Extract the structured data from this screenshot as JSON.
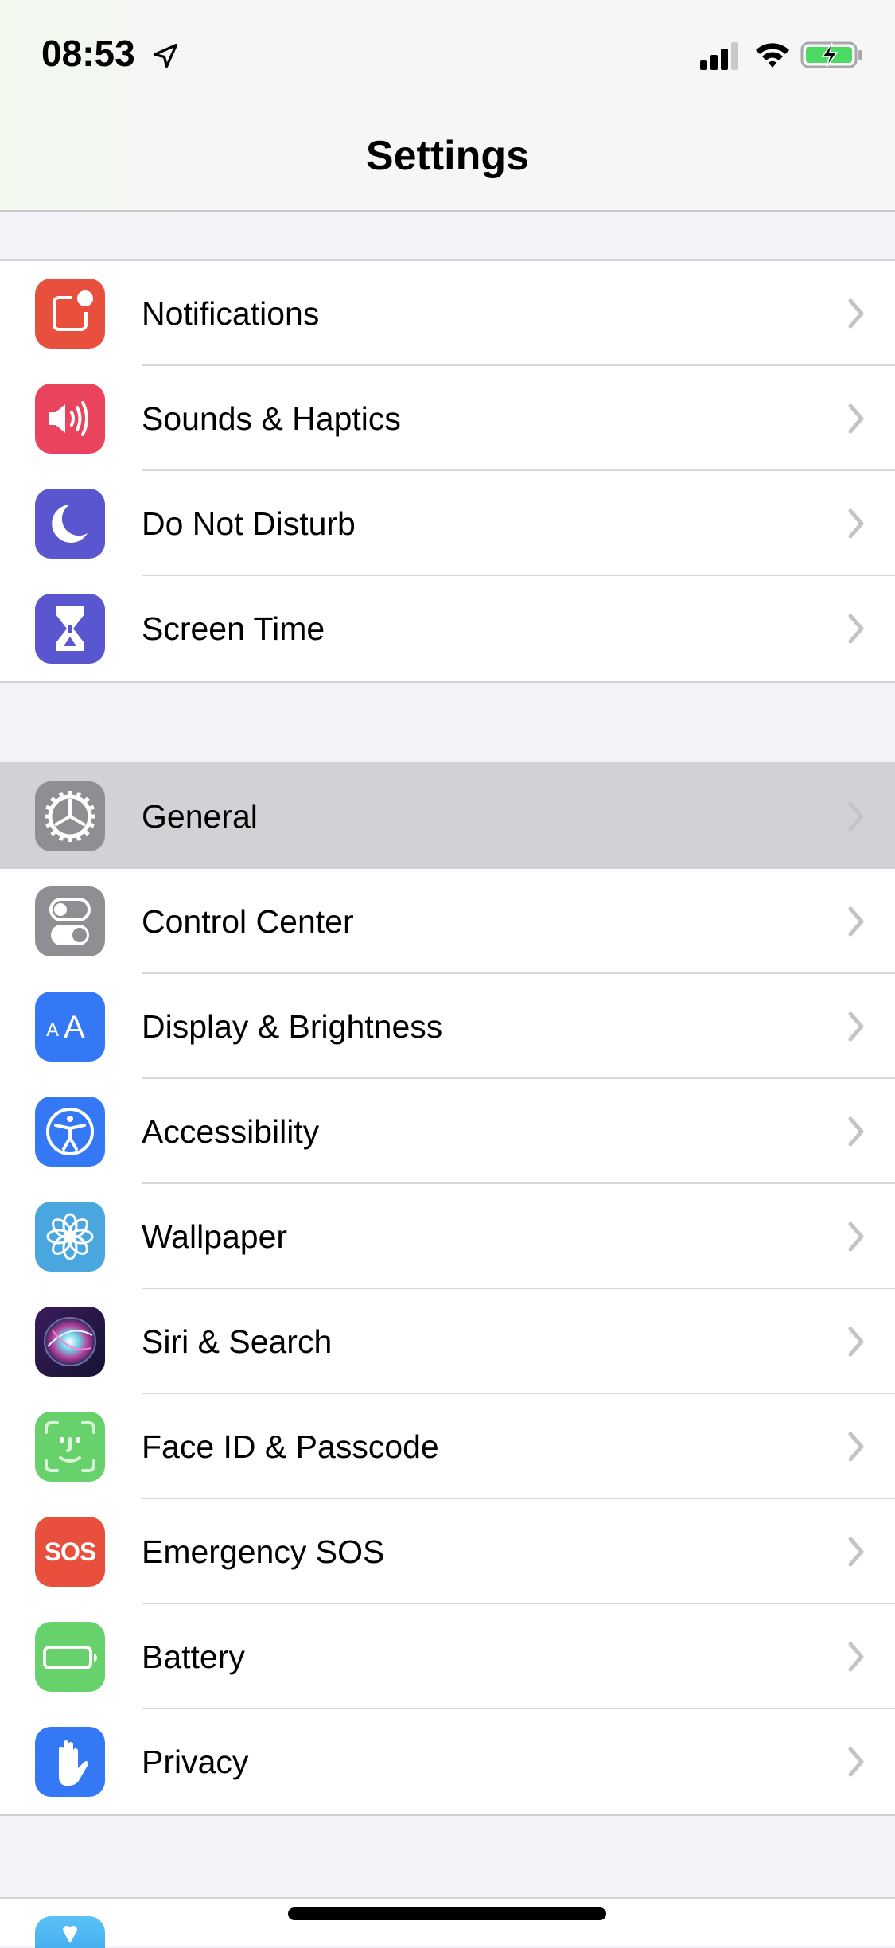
{
  "status_bar": {
    "time": "08:53",
    "location_icon": "location-arrow-icon",
    "signal_icon": "cellular-signal-icon",
    "wifi_icon": "wifi-icon",
    "battery_icon": "battery-charging-icon",
    "battery_color": "#4cd964"
  },
  "header": {
    "title": "Settings"
  },
  "groups": [
    {
      "items": [
        {
          "label": "Notifications",
          "icon": "notifications-icon",
          "color": "#e94f3d"
        },
        {
          "label": "Sounds & Haptics",
          "icon": "speaker-icon",
          "color": "#e9435d"
        },
        {
          "label": "Do Not Disturb",
          "icon": "moon-icon",
          "color": "#5956d0"
        },
        {
          "label": "Screen Time",
          "icon": "hourglass-icon",
          "color": "#5956d0"
        }
      ]
    },
    {
      "items": [
        {
          "label": "General",
          "icon": "gear-icon",
          "color": "#8e8e93",
          "selected": true
        },
        {
          "label": "Control Center",
          "icon": "toggles-icon",
          "color": "#8e8e93"
        },
        {
          "label": "Display & Brightness",
          "icon": "text-size-icon",
          "color": "#3478f6",
          "glyph": "AA"
        },
        {
          "label": "Accessibility",
          "icon": "accessibility-icon",
          "color": "#3478f6"
        },
        {
          "label": "Wallpaper",
          "icon": "flower-icon",
          "color": "#4aa6de"
        },
        {
          "label": "Siri & Search",
          "icon": "siri-icon",
          "color": "#1c1c3a"
        },
        {
          "label": "Face ID & Passcode",
          "icon": "face-id-icon",
          "color": "#67d16c"
        },
        {
          "label": "Emergency SOS",
          "icon": "sos-icon",
          "color": "#e94f3d",
          "glyph": "SOS"
        },
        {
          "label": "Battery",
          "icon": "battery-icon",
          "color": "#67d16c"
        },
        {
          "label": "Privacy",
          "icon": "hand-icon",
          "color": "#3478f6"
        }
      ]
    }
  ],
  "partial_next_item": {
    "icon": "heart-icon",
    "color": "#5ac2f7"
  }
}
